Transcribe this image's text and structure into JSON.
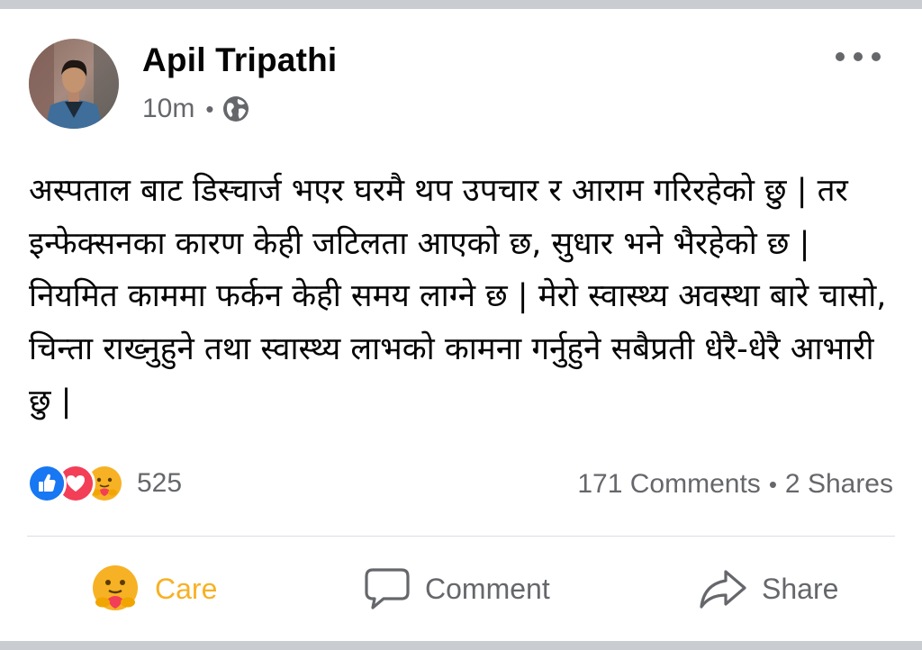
{
  "post": {
    "author": "Apil Tripathi",
    "time": "10m",
    "privacy_icon": "globe-icon",
    "text": "अस्पताल बाट डिस्चार्ज भएर घरमै थप उपचार र आराम गरिरहेको छु | तर इन्फेक्सनका कारण केही जटिलता आएको छ, सुधार भने भैरहेको छ | नियमित काममा फर्कन केही समय लाग्ने छ | मेरो स्वास्थ्य अवस्था बारे चासो, चिन्ता राख्नुहुने तथा स्वास्थ्य लाभको कामना गर्नुहुने सबैप्रती धेरै-धेरै आभारी छु |"
  },
  "reactions": {
    "icons": [
      "like-icon",
      "love-icon",
      "care-icon"
    ],
    "count": "525"
  },
  "stats": {
    "comments": "171 Comments",
    "shares": "2 Shares"
  },
  "actions": {
    "care": "Care",
    "comment": "Comment",
    "share": "Share"
  },
  "colors": {
    "like_blue": "#1877f2",
    "love_red": "#f33e58",
    "care_yellow": "#f7b125",
    "secondary_text": "#65676b",
    "divider": "#dadde1",
    "frame": "#c9ccd1"
  }
}
